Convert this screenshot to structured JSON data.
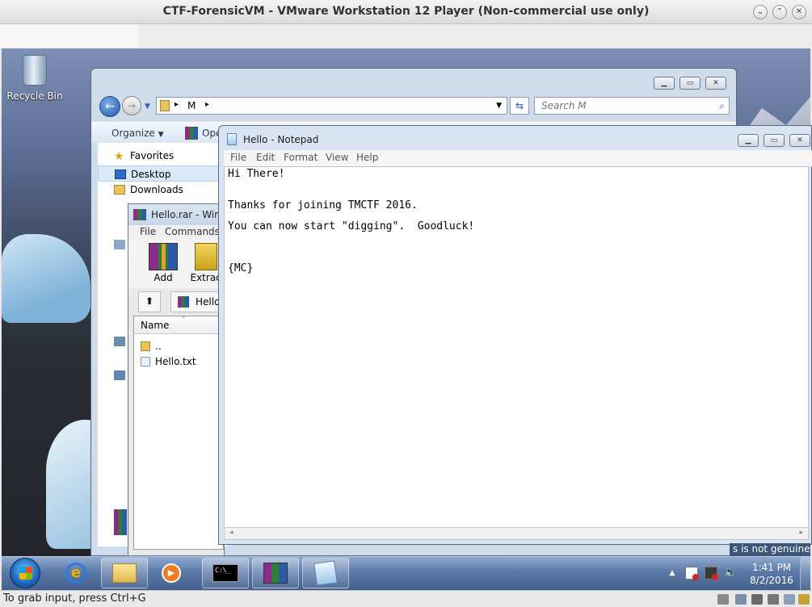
{
  "host": {
    "title": "CTF-ForensicVM - VMware Workstation 12 Player (Non-commercial use only)",
    "status_text": "To grab input, press Ctrl+G"
  },
  "desktop": {
    "recycle_bin_label": "Recycle Bin",
    "genuine_watermark": "s is not genuine"
  },
  "explorer": {
    "address_path": "M",
    "search_placeholder": "Search M",
    "organize_label": "Organize",
    "open_label": "Ope",
    "nav": {
      "favorites": "Favorites",
      "desktop": "Desktop",
      "downloads": "Downloads"
    }
  },
  "winrar": {
    "title": "Hello.rar - WinR",
    "menu": [
      "File",
      "Commands"
    ],
    "tools": [
      "Add",
      "Extract"
    ],
    "path_label": "Hello",
    "column_name": "Name",
    "rows": [
      {
        "name": ".."
      },
      {
        "name": "Hello.txt"
      }
    ]
  },
  "notepad": {
    "title": "Hello - Notepad",
    "menu": [
      "File",
      "Edit",
      "Format",
      "View",
      "Help"
    ],
    "lines": [
      "Hi There!",
      "Thanks for joining TMCTF 2016.",
      "You can now start \"digging\".  Goodluck!",
      "{MC}"
    ]
  },
  "taskbar": {
    "time": "1:41 PM",
    "date": "8/2/2016",
    "cmd_label": "C:\\_"
  },
  "colors": {
    "accent": "#2b63b7",
    "taskbar": "#5b79a8"
  }
}
